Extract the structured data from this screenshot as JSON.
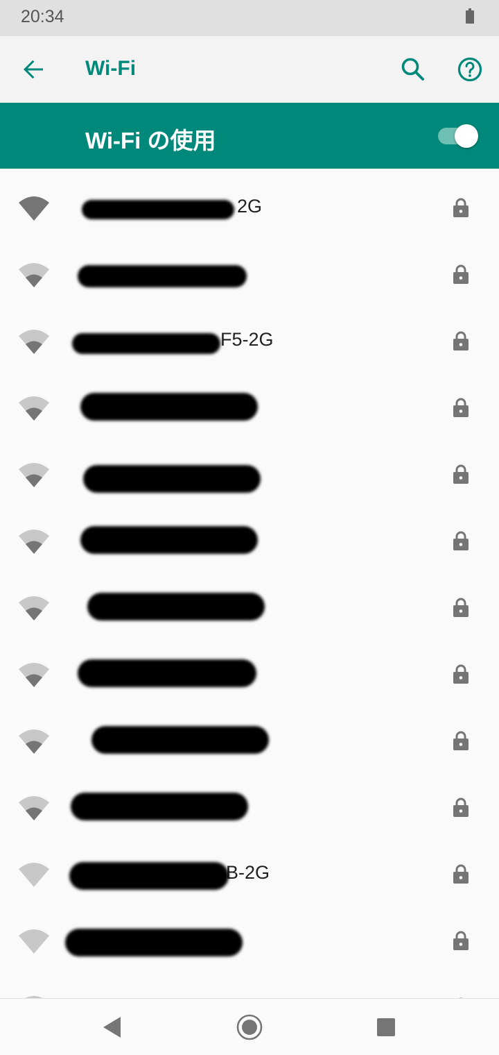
{
  "status_bar": {
    "time": "20:34"
  },
  "app_bar": {
    "title": "Wi-Fi",
    "back_icon": "arrow-back-icon",
    "search_icon": "search-icon",
    "help_icon": "help-circle-icon"
  },
  "master_switch": {
    "label": "Wi-Fi の使用",
    "state": "on"
  },
  "networks": [
    {
      "visible_name": "2G",
      "signal_level": 4,
      "secured": true
    },
    {
      "visible_name": "",
      "signal_level": 2,
      "secured": true
    },
    {
      "visible_name": "F5-2G",
      "signal_level": 2,
      "secured": true
    },
    {
      "visible_name": "",
      "signal_level": 2,
      "secured": true
    },
    {
      "visible_name": "",
      "signal_level": 2,
      "secured": true
    },
    {
      "visible_name": "",
      "signal_level": 2,
      "secured": true
    },
    {
      "visible_name": "",
      "signal_level": 2,
      "secured": true
    },
    {
      "visible_name": "",
      "signal_level": 2,
      "secured": true
    },
    {
      "visible_name": "",
      "signal_level": 2,
      "secured": true
    },
    {
      "visible_name": "",
      "signal_level": 2,
      "secured": true
    },
    {
      "visible_name": "B-2G",
      "signal_level": 0,
      "secured": true
    },
    {
      "visible_name": "",
      "signal_level": 0,
      "secured": true
    },
    {
      "visible_name": "",
      "signal_level": 0,
      "secured": true
    }
  ],
  "colors": {
    "accent": "#00897b",
    "status_bar": "#e0e0e0",
    "app_bar": "#f3f3f3",
    "background": "#fafafa"
  }
}
